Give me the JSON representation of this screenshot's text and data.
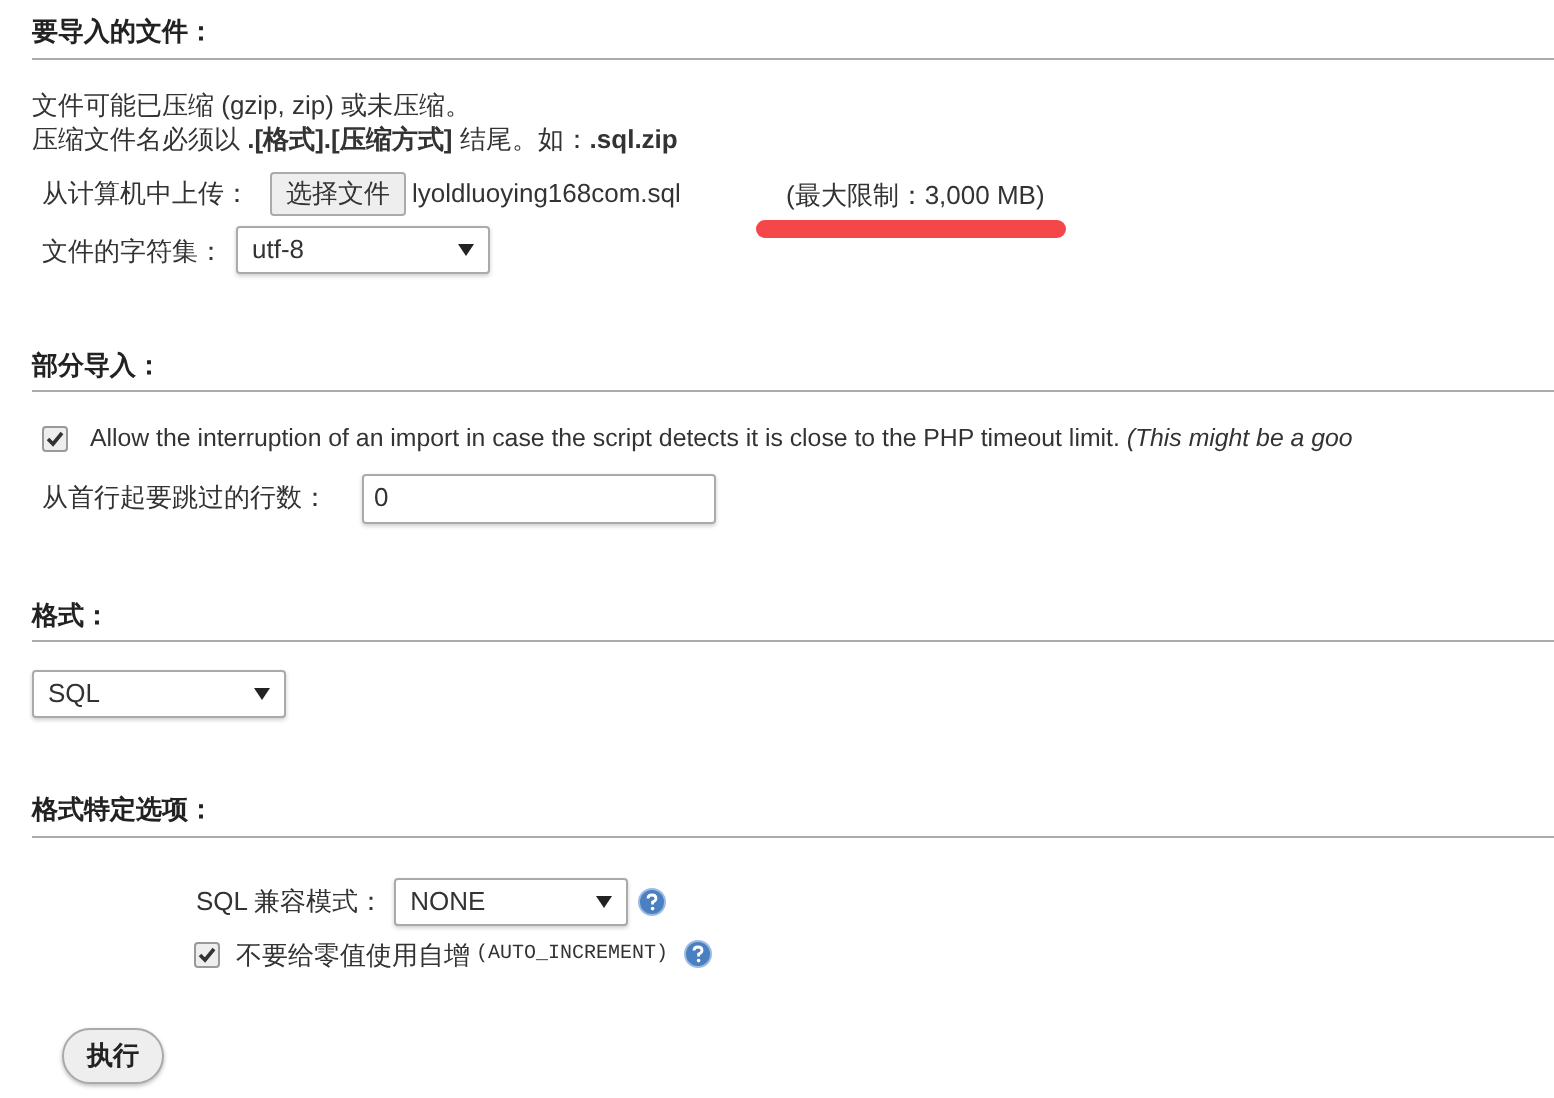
{
  "file_section": {
    "heading": "要导入的文件：",
    "notes": [
      "文件可能已压缩 (gzip, zip) 或未压缩。",
      "压缩文件名必须以 **.[格式].[压缩方式]** 结尾。如：**.sql.zip**"
    ],
    "upload_label": "从计算机中上传：",
    "choose_button": "选择文件",
    "file_name": "lyoldluoying168com.sql",
    "max_size": "(最大限制：3,000 MB)",
    "highlighted": true,
    "charset_label": "文件的字符集：",
    "charset_value": "utf-8"
  },
  "partial_section": {
    "heading": "部分导入：",
    "allow_interrupt": {
      "label": "Allow the interruption of an import in case the script detects it is close to the PHP timeout limit. *(This might be a goo*",
      "checked": true
    },
    "skip_label": "从首行起要跳过的行数：",
    "skip_value": "0"
  },
  "format_section": {
    "heading": "格式：",
    "format_value": "SQL"
  },
  "options_section": {
    "heading": "格式特定选项：",
    "compat_label": "SQL 兼容模式：",
    "compat_value": "NONE",
    "no_auto_value": {
      "label": "不要给零值使用自增",
      "code": "(AUTO_INCREMENT)",
      "checked": true
    }
  },
  "go_button": "执行"
}
